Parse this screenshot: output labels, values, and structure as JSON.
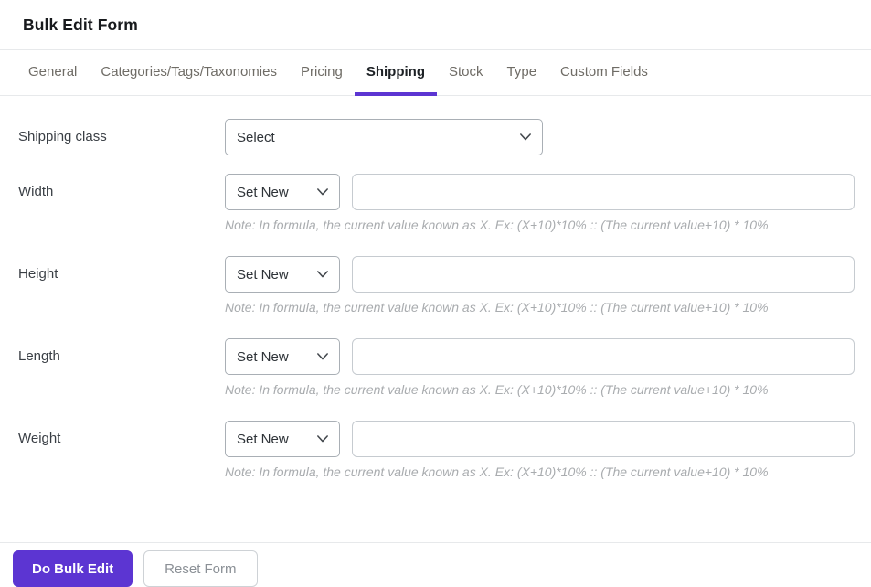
{
  "header": {
    "title": "Bulk Edit Form"
  },
  "tabs": [
    {
      "label": "General",
      "active": false
    },
    {
      "label": "Categories/Tags/Taxonomies",
      "active": false
    },
    {
      "label": "Pricing",
      "active": false
    },
    {
      "label": "Shipping",
      "active": true
    },
    {
      "label": "Stock",
      "active": false
    },
    {
      "label": "Type",
      "active": false
    },
    {
      "label": "Custom Fields",
      "active": false
    }
  ],
  "form": {
    "note": "Note: In formula, the current value known as X. Ex: (X+10)*10% :: (The current value+10) * 10%",
    "rows": [
      {
        "label": "Shipping class",
        "select_value": "Select"
      },
      {
        "label": "Width",
        "select_value": "Set New",
        "input_value": ""
      },
      {
        "label": "Height",
        "select_value": "Set New",
        "input_value": ""
      },
      {
        "label": "Length",
        "select_value": "Set New",
        "input_value": ""
      },
      {
        "label": "Weight",
        "select_value": "Set New",
        "input_value": ""
      }
    ]
  },
  "footer": {
    "submit_label": "Do Bulk Edit",
    "reset_label": "Reset Form"
  },
  "colors": {
    "accent": "#5c35d2",
    "tab_underline": "#5a2ed0",
    "note_text": "#a9acaf"
  }
}
